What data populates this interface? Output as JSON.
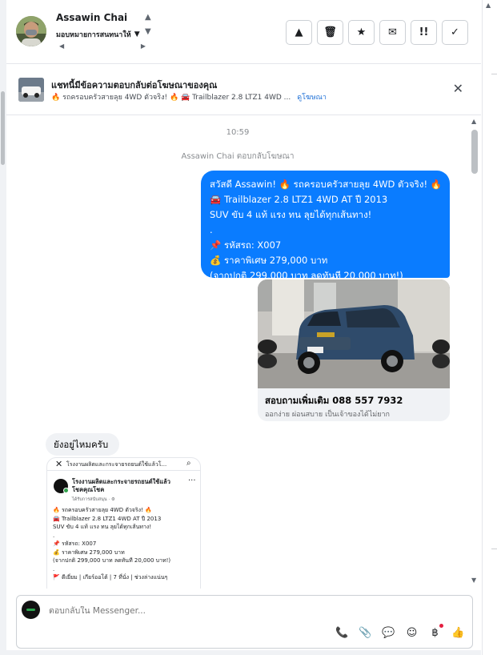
{
  "header": {
    "contact_name": "Assawin Chai",
    "assign_label": "มอบหมายการสนทนาให้",
    "actions": [
      {
        "name": "report-button",
        "icon": "warning-icon",
        "glyph": "▲"
      },
      {
        "name": "delete-button",
        "icon": "trash-icon",
        "glyph": "🗑"
      },
      {
        "name": "star-button",
        "icon": "star-icon",
        "glyph": "★"
      },
      {
        "name": "mark-unread-button",
        "icon": "envelope-open-icon",
        "glyph": "✉"
      },
      {
        "name": "priority-button",
        "icon": "priority-icon",
        "glyph": "!!"
      },
      {
        "name": "done-button",
        "icon": "check-icon",
        "glyph": "✓"
      }
    ]
  },
  "ad_banner": {
    "title": "แชทนี้มีข้อความตอบกลับต่อโฆษณาของคุณ",
    "subtitle": "🔥 รถครอบครัวสายลุย 4WD ตัวจริง! 🔥 🚘 Trailblazer 2.8 LTZ1 4WD ...",
    "link": "ดูโฆษณา"
  },
  "chat": {
    "timestamp": "10:59",
    "reply_note": "Assawin Chai ตอบกลับโฆษณา",
    "outgoing_lines": [
      "สวัสดี Assawin! 🔥 รถครอบครัวสายลุย 4WD ตัวจริง! 🔥",
      "🚘 Trailblazer 2.8 LTZ1 4WD AT ปี 2013",
      "SUV ขับ 4 แท้ แรง ทน ลุยได้ทุกเส้นทาง!",
      ".",
      "📌 รหัสรถ: X007",
      "💰 ราคาพิเศษ 279,000 บาท",
      "(จากปกติ 299,000 บาท ลดทันที 20,000 บาท!)"
    ],
    "card": {
      "title": "สอบถามเพิ่มเติม 088 557 7932",
      "subtitle": "ออกง่าย ผ่อนสบาย เป็นเจ้าของได้ไม่ยาก"
    },
    "incoming_text": "ยังอยู่ไหมครับ",
    "shared_post": {
      "top_text": "โรงงานผลิตและกระจายรถยนต์ใช้แล้วโ...",
      "page_name": "โรงงานผลิตและกระจายรถยนต์ใช้แล้ว โชคคุณโชค",
      "meta": "ได้รับการสนับสนุน · ⚙",
      "lines": [
        "🔥 รถครอบครัวสายลุย 4WD ตัวจริง! 🔥",
        "🚘 Trailblazer 2.8 LTZ1 4WD AT ปี 2013",
        "SUV ขับ 4 แท้ แรง ทน ลุยได้ทุกเส้นทาง!",
        ".",
        "📌 รหัสรถ: X007",
        "💰 ราคาพิเศษ 279,000 บาท",
        "(จากปกติ 299,000 บาท ลดทันที 20,000 บาท!)",
        ".",
        "🚩 ดีเยี่ยม | เกียร์ออโต้ | 7 ที่นั่ง | ช่วงล่างแน่นๆ"
      ]
    }
  },
  "composer": {
    "placeholder": "ตอบกลับใน Messenger...",
    "tools": [
      {
        "name": "call-button",
        "icon": "phone-plus-icon",
        "glyph": "📞"
      },
      {
        "name": "attach-button",
        "icon": "paperclip-icon",
        "glyph": "📎"
      },
      {
        "name": "saved-replies-button",
        "icon": "chat-bubble-icon",
        "glyph": "💬"
      },
      {
        "name": "emoji-button",
        "icon": "smiley-icon",
        "glyph": "☺"
      },
      {
        "name": "payment-button",
        "icon": "payment-icon",
        "glyph": "฿"
      },
      {
        "name": "like-button",
        "icon": "thumbs-up-icon",
        "glyph": "👍"
      }
    ]
  }
}
